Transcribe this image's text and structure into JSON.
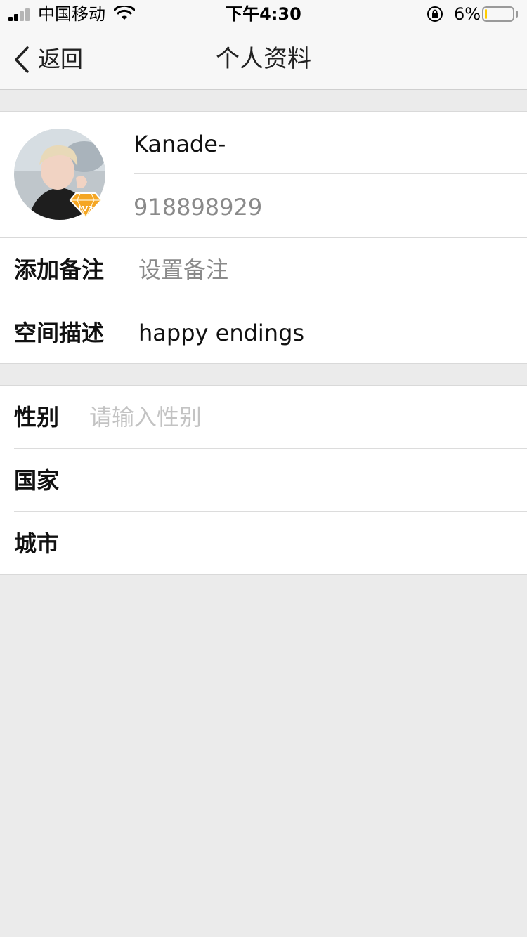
{
  "status_bar": {
    "carrier": "中国移动",
    "time": "下午4:30",
    "battery_percent": "6%",
    "battery_level": 0.06,
    "icons": [
      "signal-icon",
      "wifi-icon",
      "rotation-lock-icon",
      "battery-icon"
    ]
  },
  "nav": {
    "back_label": "返回",
    "title": "个人资料"
  },
  "profile": {
    "nickname": "Kanade-",
    "account_id": "918898929",
    "badge_text": "LV3"
  },
  "rows": {
    "remark": {
      "label": "添加备注",
      "value": "设置备注"
    },
    "space_desc": {
      "label": "空间描述",
      "value": "happy endings"
    },
    "gender": {
      "label": "性别",
      "placeholder": "请输入性别"
    },
    "country": {
      "label": "国家",
      "value": ""
    },
    "city": {
      "label": "城市",
      "value": ""
    }
  },
  "colors": {
    "background": "#ebebeb",
    "bar": "#f7f7f7",
    "badge_gold": "#f5a623",
    "battery_fill": "#ffcc00",
    "placeholder": "#c3c3c3",
    "secondary_text": "#8a8a8a"
  }
}
